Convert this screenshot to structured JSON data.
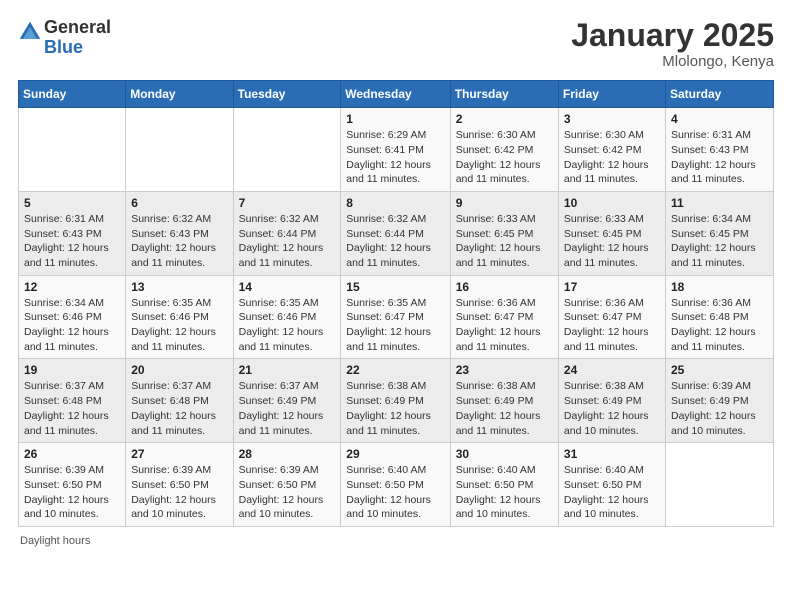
{
  "logo": {
    "general": "General",
    "blue": "Blue"
  },
  "title": {
    "month": "January 2025",
    "location": "Mlolongo, Kenya"
  },
  "weekdays": [
    "Sunday",
    "Monday",
    "Tuesday",
    "Wednesday",
    "Thursday",
    "Friday",
    "Saturday"
  ],
  "weeks": [
    [
      {
        "day": "",
        "sunrise": "",
        "sunset": "",
        "daylight": ""
      },
      {
        "day": "",
        "sunrise": "",
        "sunset": "",
        "daylight": ""
      },
      {
        "day": "",
        "sunrise": "",
        "sunset": "",
        "daylight": ""
      },
      {
        "day": "1",
        "sunrise": "Sunrise: 6:29 AM",
        "sunset": "Sunset: 6:41 PM",
        "daylight": "Daylight: 12 hours and 11 minutes."
      },
      {
        "day": "2",
        "sunrise": "Sunrise: 6:30 AM",
        "sunset": "Sunset: 6:42 PM",
        "daylight": "Daylight: 12 hours and 11 minutes."
      },
      {
        "day": "3",
        "sunrise": "Sunrise: 6:30 AM",
        "sunset": "Sunset: 6:42 PM",
        "daylight": "Daylight: 12 hours and 11 minutes."
      },
      {
        "day": "4",
        "sunrise": "Sunrise: 6:31 AM",
        "sunset": "Sunset: 6:43 PM",
        "daylight": "Daylight: 12 hours and 11 minutes."
      }
    ],
    [
      {
        "day": "5",
        "sunrise": "Sunrise: 6:31 AM",
        "sunset": "Sunset: 6:43 PM",
        "daylight": "Daylight: 12 hours and 11 minutes."
      },
      {
        "day": "6",
        "sunrise": "Sunrise: 6:32 AM",
        "sunset": "Sunset: 6:43 PM",
        "daylight": "Daylight: 12 hours and 11 minutes."
      },
      {
        "day": "7",
        "sunrise": "Sunrise: 6:32 AM",
        "sunset": "Sunset: 6:44 PM",
        "daylight": "Daylight: 12 hours and 11 minutes."
      },
      {
        "day": "8",
        "sunrise": "Sunrise: 6:32 AM",
        "sunset": "Sunset: 6:44 PM",
        "daylight": "Daylight: 12 hours and 11 minutes."
      },
      {
        "day": "9",
        "sunrise": "Sunrise: 6:33 AM",
        "sunset": "Sunset: 6:45 PM",
        "daylight": "Daylight: 12 hours and 11 minutes."
      },
      {
        "day": "10",
        "sunrise": "Sunrise: 6:33 AM",
        "sunset": "Sunset: 6:45 PM",
        "daylight": "Daylight: 12 hours and 11 minutes."
      },
      {
        "day": "11",
        "sunrise": "Sunrise: 6:34 AM",
        "sunset": "Sunset: 6:45 PM",
        "daylight": "Daylight: 12 hours and 11 minutes."
      }
    ],
    [
      {
        "day": "12",
        "sunrise": "Sunrise: 6:34 AM",
        "sunset": "Sunset: 6:46 PM",
        "daylight": "Daylight: 12 hours and 11 minutes."
      },
      {
        "day": "13",
        "sunrise": "Sunrise: 6:35 AM",
        "sunset": "Sunset: 6:46 PM",
        "daylight": "Daylight: 12 hours and 11 minutes."
      },
      {
        "day": "14",
        "sunrise": "Sunrise: 6:35 AM",
        "sunset": "Sunset: 6:46 PM",
        "daylight": "Daylight: 12 hours and 11 minutes."
      },
      {
        "day": "15",
        "sunrise": "Sunrise: 6:35 AM",
        "sunset": "Sunset: 6:47 PM",
        "daylight": "Daylight: 12 hours and 11 minutes."
      },
      {
        "day": "16",
        "sunrise": "Sunrise: 6:36 AM",
        "sunset": "Sunset: 6:47 PM",
        "daylight": "Daylight: 12 hours and 11 minutes."
      },
      {
        "day": "17",
        "sunrise": "Sunrise: 6:36 AM",
        "sunset": "Sunset: 6:47 PM",
        "daylight": "Daylight: 12 hours and 11 minutes."
      },
      {
        "day": "18",
        "sunrise": "Sunrise: 6:36 AM",
        "sunset": "Sunset: 6:48 PM",
        "daylight": "Daylight: 12 hours and 11 minutes."
      }
    ],
    [
      {
        "day": "19",
        "sunrise": "Sunrise: 6:37 AM",
        "sunset": "Sunset: 6:48 PM",
        "daylight": "Daylight: 12 hours and 11 minutes."
      },
      {
        "day": "20",
        "sunrise": "Sunrise: 6:37 AM",
        "sunset": "Sunset: 6:48 PM",
        "daylight": "Daylight: 12 hours and 11 minutes."
      },
      {
        "day": "21",
        "sunrise": "Sunrise: 6:37 AM",
        "sunset": "Sunset: 6:49 PM",
        "daylight": "Daylight: 12 hours and 11 minutes."
      },
      {
        "day": "22",
        "sunrise": "Sunrise: 6:38 AM",
        "sunset": "Sunset: 6:49 PM",
        "daylight": "Daylight: 12 hours and 11 minutes."
      },
      {
        "day": "23",
        "sunrise": "Sunrise: 6:38 AM",
        "sunset": "Sunset: 6:49 PM",
        "daylight": "Daylight: 12 hours and 11 minutes."
      },
      {
        "day": "24",
        "sunrise": "Sunrise: 6:38 AM",
        "sunset": "Sunset: 6:49 PM",
        "daylight": "Daylight: 12 hours and 10 minutes."
      },
      {
        "day": "25",
        "sunrise": "Sunrise: 6:39 AM",
        "sunset": "Sunset: 6:49 PM",
        "daylight": "Daylight: 12 hours and 10 minutes."
      }
    ],
    [
      {
        "day": "26",
        "sunrise": "Sunrise: 6:39 AM",
        "sunset": "Sunset: 6:50 PM",
        "daylight": "Daylight: 12 hours and 10 minutes."
      },
      {
        "day": "27",
        "sunrise": "Sunrise: 6:39 AM",
        "sunset": "Sunset: 6:50 PM",
        "daylight": "Daylight: 12 hours and 10 minutes."
      },
      {
        "day": "28",
        "sunrise": "Sunrise: 6:39 AM",
        "sunset": "Sunset: 6:50 PM",
        "daylight": "Daylight: 12 hours and 10 minutes."
      },
      {
        "day": "29",
        "sunrise": "Sunrise: 6:40 AM",
        "sunset": "Sunset: 6:50 PM",
        "daylight": "Daylight: 12 hours and 10 minutes."
      },
      {
        "day": "30",
        "sunrise": "Sunrise: 6:40 AM",
        "sunset": "Sunset: 6:50 PM",
        "daylight": "Daylight: 12 hours and 10 minutes."
      },
      {
        "day": "31",
        "sunrise": "Sunrise: 6:40 AM",
        "sunset": "Sunset: 6:50 PM",
        "daylight": "Daylight: 12 hours and 10 minutes."
      },
      {
        "day": "",
        "sunrise": "",
        "sunset": "",
        "daylight": ""
      }
    ]
  ],
  "footer": {
    "daylight_hours": "Daylight hours"
  }
}
